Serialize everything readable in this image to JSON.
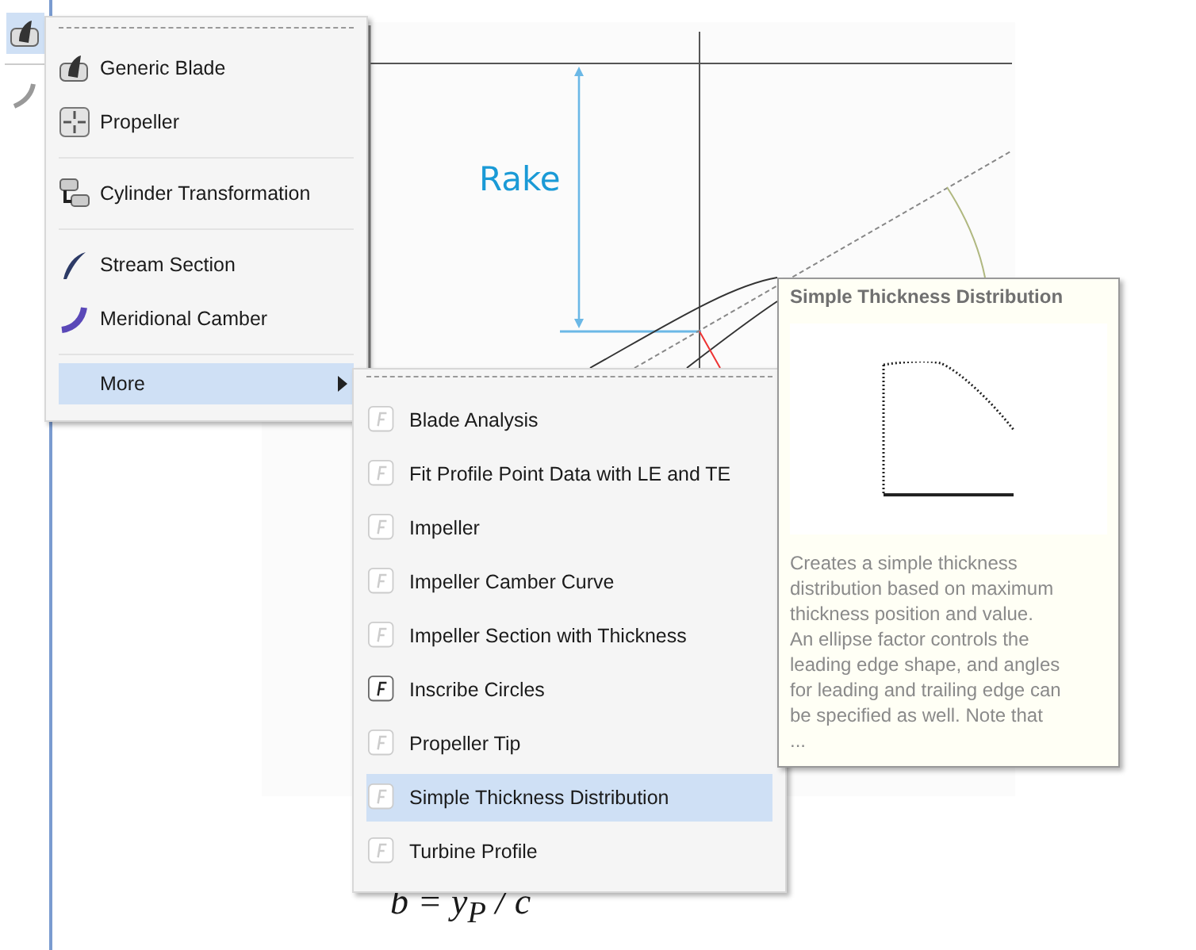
{
  "toolbar": [
    {
      "kind": "blade",
      "selected": true
    },
    {
      "kind": "curve",
      "selected": false
    }
  ],
  "diagram": {
    "label": "Rake",
    "formula": "b = y$_{P}$ / c"
  },
  "menu": {
    "groups": [
      [
        {
          "kind": "blade",
          "label": "Generic Blade",
          "selected": false
        },
        {
          "kind": "propeller",
          "label": "Propeller",
          "selected": false
        }
      ],
      [
        {
          "kind": "cylinder",
          "label": "Cylinder Transformation",
          "selected": false
        }
      ],
      [
        {
          "kind": "stream",
          "label": "Stream Section",
          "selected": false
        },
        {
          "kind": "meridional",
          "label": "Meridional Camber",
          "selected": false
        }
      ],
      [
        {
          "kind": "more",
          "label": "More",
          "selected": true
        }
      ]
    ]
  },
  "submenu": {
    "items": [
      {
        "label": "Blade Analysis",
        "bold_icon": false,
        "selected": false
      },
      {
        "label": "Fit Profile Point Data with LE and TE",
        "bold_icon": false,
        "selected": false
      },
      {
        "label": "Impeller",
        "bold_icon": false,
        "selected": false
      },
      {
        "label": "Impeller Camber Curve",
        "bold_icon": false,
        "selected": false
      },
      {
        "label": "Impeller Section with Thickness",
        "bold_icon": false,
        "selected": false
      },
      {
        "label": "Inscribe Circles",
        "bold_icon": true,
        "selected": false
      },
      {
        "label": "Propeller Tip",
        "bold_icon": false,
        "selected": false
      },
      {
        "label": "Simple Thickness Distribution",
        "bold_icon": false,
        "selected": true
      },
      {
        "label": "Turbine Profile",
        "bold_icon": false,
        "selected": false
      }
    ]
  },
  "tooltip": {
    "title": "Simple Thickness Distribution",
    "description": "Creates a simple thickness\ndistribution based on maximum\nthickness position and value.\nAn ellipse factor controls the\nleading edge shape, and angles\nfor leading and trailing edge can\nbe specified as well. Note that\n..."
  }
}
